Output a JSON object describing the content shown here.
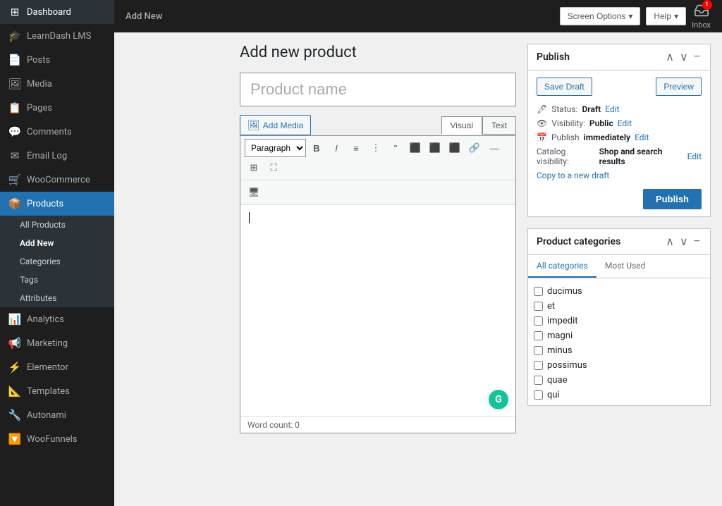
{
  "sidebar": {
    "items": [
      {
        "id": "dashboard",
        "label": "Dashboard",
        "icon": "⊞"
      },
      {
        "id": "learndash",
        "label": "LearnDash LMS",
        "icon": "🎓"
      },
      {
        "id": "posts",
        "label": "Posts",
        "icon": "📄"
      },
      {
        "id": "media",
        "label": "Media",
        "icon": "🖼"
      },
      {
        "id": "pages",
        "label": "Pages",
        "icon": "📋"
      },
      {
        "id": "comments",
        "label": "Comments",
        "icon": "💬"
      },
      {
        "id": "email-log",
        "label": "Email Log",
        "icon": "✉"
      },
      {
        "id": "woocommerce",
        "label": "WooCommerce",
        "icon": "🛒"
      },
      {
        "id": "products",
        "label": "Products",
        "icon": "📦"
      },
      {
        "id": "analytics",
        "label": "Analytics",
        "icon": "📊"
      },
      {
        "id": "marketing",
        "label": "Marketing",
        "icon": "📢"
      },
      {
        "id": "elementor",
        "label": "Elementor",
        "icon": "⚡"
      },
      {
        "id": "templates",
        "label": "Templates",
        "icon": "📐"
      },
      {
        "id": "autonami",
        "label": "Autonami",
        "icon": "🔧"
      },
      {
        "id": "woofunnels",
        "label": "WooFunnels",
        "icon": "🔽"
      }
    ],
    "products_submenu": [
      {
        "id": "all-products",
        "label": "All Products"
      },
      {
        "id": "add-new",
        "label": "Add New"
      },
      {
        "id": "categories",
        "label": "Categories"
      },
      {
        "id": "tags",
        "label": "Tags"
      },
      {
        "id": "attributes",
        "label": "Attributes"
      }
    ]
  },
  "topbar": {
    "title": "Add New",
    "screen_options": "Screen Options",
    "help": "Help",
    "inbox_label": "Inbox",
    "inbox_count": "1"
  },
  "page": {
    "title": "Add new product",
    "product_name_placeholder": "Product name"
  },
  "editor": {
    "add_media_label": "Add Media",
    "visual_tab": "Visual",
    "text_tab": "Text",
    "format_select": "Paragraph",
    "word_count_label": "Word count: 0"
  },
  "publish_panel": {
    "title": "Publish",
    "save_draft_label": "Save Draft",
    "preview_label": "Preview",
    "status_label": "Status:",
    "status_value": "Draft",
    "status_edit": "Edit",
    "visibility_label": "Visibility:",
    "visibility_value": "Public",
    "visibility_edit": "Edit",
    "publish_label": "Publish",
    "publish_value": "immediately",
    "publish_edit": "Edit",
    "catalog_label": "Catalog visibility:",
    "catalog_value": "Shop and search results",
    "catalog_edit": "Edit",
    "copy_draft": "Copy to a new draft",
    "publish_btn": "Publish"
  },
  "categories_panel": {
    "title": "Product categories",
    "tab_all": "All categories",
    "tab_most_used": "Most Used",
    "items": [
      {
        "label": "ducimus",
        "checked": false
      },
      {
        "label": "et",
        "checked": false
      },
      {
        "label": "impedit",
        "checked": false
      },
      {
        "label": "magni",
        "checked": false
      },
      {
        "label": "minus",
        "checked": false
      },
      {
        "label": "possimus",
        "checked": false
      },
      {
        "label": "quae",
        "checked": false
      },
      {
        "label": "qui",
        "checked": false
      }
    ]
  }
}
